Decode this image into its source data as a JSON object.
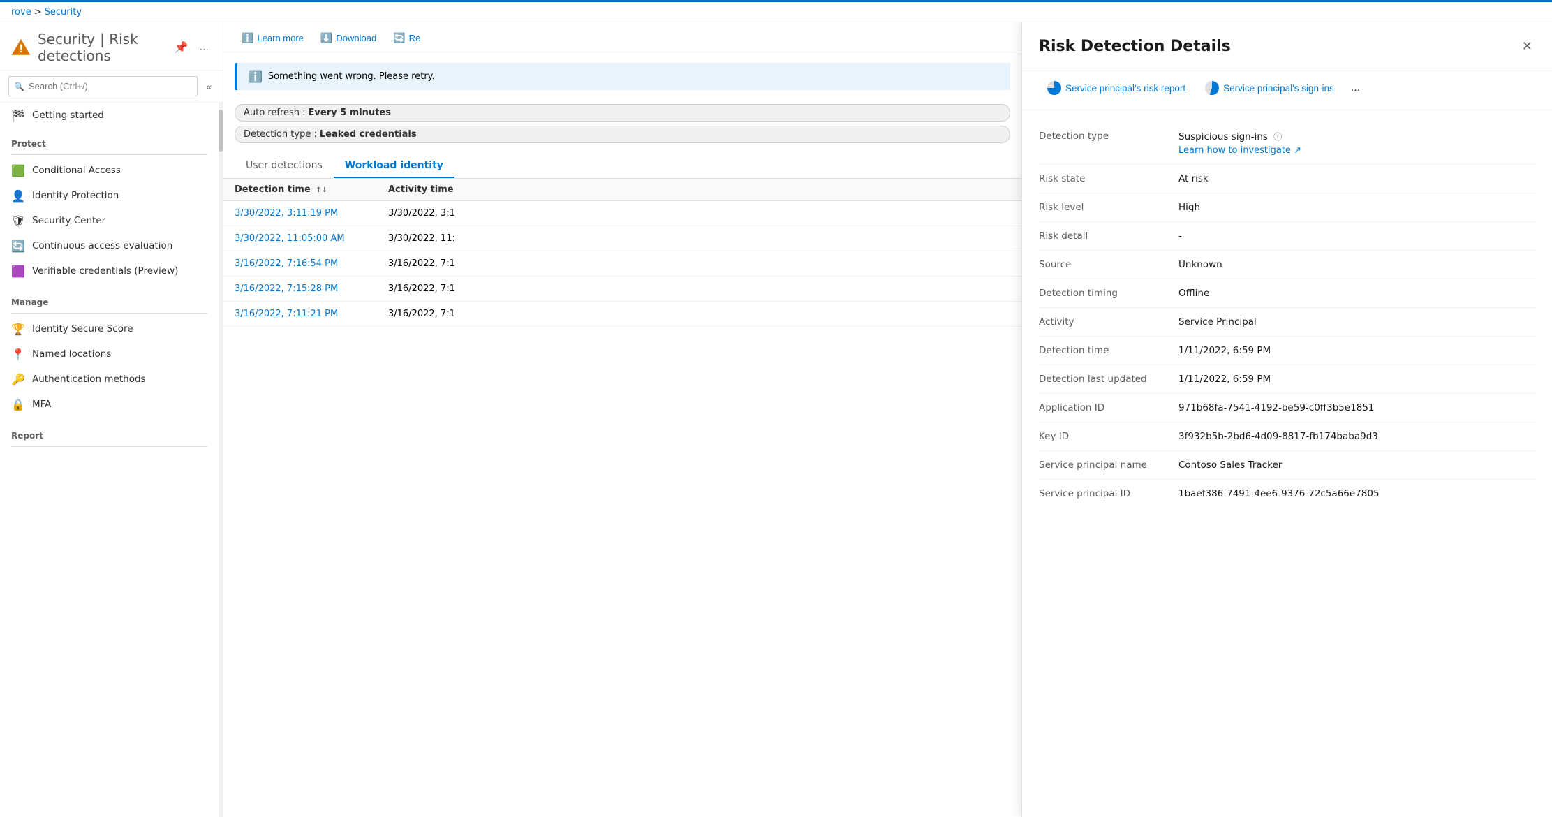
{
  "breadcrumb": {
    "parent": "rove",
    "separator": ">",
    "current": "Security"
  },
  "header": {
    "title": "Security",
    "subtitle": "Risk detections",
    "warning_icon": "⚠",
    "pin_icon": "📌",
    "more_icon": "..."
  },
  "search": {
    "placeholder": "Search (Ctrl+/)"
  },
  "sidebar": {
    "nav_item_getting_started": "Getting started",
    "section_protect": "Protect",
    "nav_conditional_access": "Conditional Access",
    "nav_identity_protection": "Identity Protection",
    "nav_security_center": "Security Center",
    "nav_continuous_access": "Continuous access evaluation",
    "nav_verifiable_credentials": "Verifiable credentials (Preview)",
    "section_manage": "Manage",
    "nav_identity_secure_score": "Identity Secure Score",
    "nav_named_locations": "Named locations",
    "nav_authentication_methods": "Authentication methods",
    "nav_mfa": "MFA",
    "section_report": "Report"
  },
  "toolbar": {
    "learn_more": "Learn more",
    "download": "Download",
    "refresh": "Re"
  },
  "error_banner": {
    "message": "Something went wrong. Please retry."
  },
  "filters": {
    "auto_refresh_label": "Auto refresh :",
    "auto_refresh_value": "Every 5 minutes",
    "detection_type_label": "Detection type :",
    "detection_type_value": "Leaked credentials"
  },
  "tabs": [
    {
      "id": "user",
      "label": "User detections",
      "active": false
    },
    {
      "id": "workload",
      "label": "Workload identity",
      "active": true
    }
  ],
  "table": {
    "columns": [
      "Detection time",
      "Activity time"
    ],
    "rows": [
      {
        "detection_time": "3/30/2022, 3:11:19 PM",
        "activity_time": "3/30/2022, 3:1"
      },
      {
        "detection_time": "3/30/2022, 11:05:00 AM",
        "activity_time": "3/30/2022, 11:"
      },
      {
        "detection_time": "3/16/2022, 7:16:54 PM",
        "activity_time": "3/16/2022, 7:1"
      },
      {
        "detection_time": "3/16/2022, 7:15:28 PM",
        "activity_time": "3/16/2022, 7:1"
      },
      {
        "detection_time": "3/16/2022, 7:11:21 PM",
        "activity_time": "3/16/2022, 7:1"
      }
    ]
  },
  "detail_panel": {
    "title": "Risk Detection Details",
    "close_icon": "✕",
    "nav_btn1_label": "Service principal's risk report",
    "nav_btn2_label": "Service principal's sign-ins",
    "nav_more_icon": "...",
    "fields": [
      {
        "label": "Detection type",
        "value": "Suspicious sign-ins",
        "has_info": true,
        "sub_value": "Learn how to investigate ↗"
      },
      {
        "label": "Risk state",
        "value": "At risk"
      },
      {
        "label": "Risk level",
        "value": "High"
      },
      {
        "label": "Risk detail",
        "value": "-"
      },
      {
        "label": "Source",
        "value": "Unknown"
      },
      {
        "label": "Detection timing",
        "value": "Offline"
      },
      {
        "label": "Activity",
        "value": "Service Principal"
      },
      {
        "label": "Detection time",
        "value": "1/11/2022, 6:59 PM"
      },
      {
        "label": "Detection last updated",
        "value": "1/11/2022, 6:59 PM"
      },
      {
        "label": "Application ID",
        "value": "971b68fa-7541-4192-be59-c0ff3b5e1851"
      },
      {
        "label": "Key ID",
        "value": "3f932b5b-2bd6-4d09-8817-fb174baba9d3"
      },
      {
        "label": "Service principal name",
        "value": "Contoso Sales Tracker"
      },
      {
        "label": "Service principal ID",
        "value": "1baef386-7491-4ee6-9376-72c5a66e7805"
      }
    ]
  }
}
